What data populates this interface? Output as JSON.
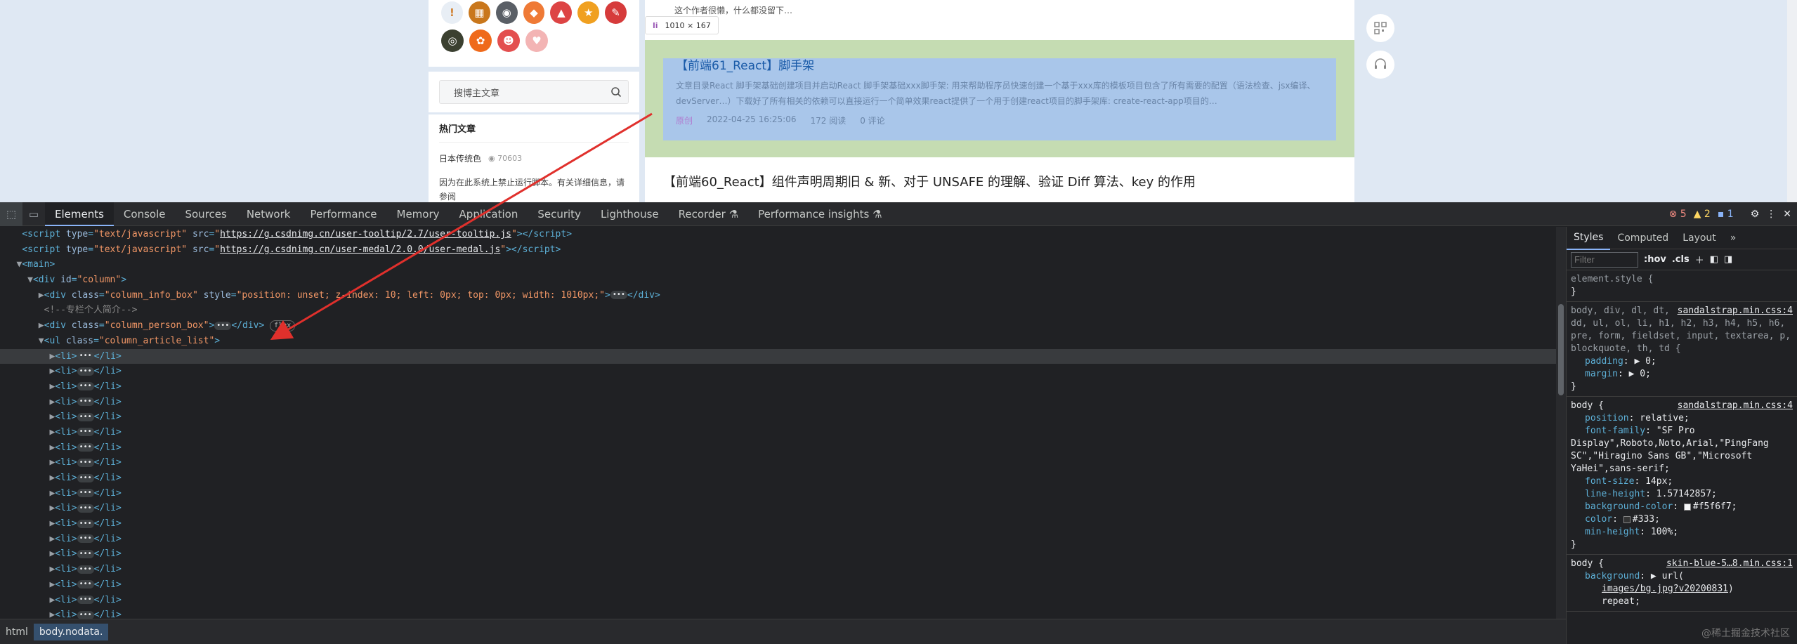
{
  "sidebar": {
    "search_placeholder": "搜博主文章",
    "hot_title": "热门文章",
    "hot_item_title": "日本传统色",
    "hot_item_views": "70603",
    "hot_item_note": "因为在此系统上禁止运行脚本。有关详细信息，请参阅"
  },
  "main": {
    "author_note": "这个作者很懒，什么都没留下…",
    "tooltip_size": "1010 × 167",
    "highlight": {
      "title": "【前端61_React】脚手架",
      "desc": "文章目录React 脚手架基础创建项目并启动React 脚手架基础xxx脚手架: 用来帮助程序员快速创建一个基于xxx库的模板项目包含了所有需要的配置（语法检查、jsx编译、devServer…）下载好了所有相关的依赖可以直接运行一个简单效果react提供了一个用于创建react项目的脚手架库: create-react-app项目的…",
      "badge": "原创",
      "date": "2022-04-25 16:25:06",
      "reads": "172 阅读",
      "comments": "0 评论"
    },
    "next_title": "【前端60_React】组件声明周期旧 & 新、对于 UNSAFE 的理解、验证 Diff 算法、key 的作用"
  },
  "devtools": {
    "tabs": [
      "Elements",
      "Console",
      "Sources",
      "Network",
      "Performance",
      "Memory",
      "Application",
      "Security",
      "Lighthouse",
      "Recorder ⚗",
      "Performance insights ⚗"
    ],
    "errors": "5",
    "warnings": "2",
    "infos": "1",
    "elements": {
      "script1_src": "https://g.csdnimg.cn/user-tooltip/2.7/user-tooltip.js",
      "script2_src": "https://g.csdnimg.cn/user-medal/2.0.0/user-medal.js",
      "column_id": "column",
      "info_box_class": "column_info_box",
      "info_box_style": "position: unset; z-index: 10; left: 0px; top: 0px; width: 1010px;",
      "comment": "<!--专栏个人简介-->",
      "person_box_class": "column_person_box",
      "flex_badge": "flex",
      "list_class": "column_article_list",
      "li_count": 18
    },
    "styles_tabs": [
      "Styles",
      "Computed",
      "Layout",
      "»"
    ],
    "filter_placeholder": "Filter",
    "filter_hov": ":hov",
    "filter_cls": ".cls",
    "element_style": "element.style {",
    "rule1_selector": "body, div, dl, dt, dd, ul, ol, li, h1, h2, h3, h4, h5, h6, pre, form, fieldset, input, textarea, p, blockquote, th, td {",
    "rule1_src": "sandalstrap.min.css:4",
    "rule2_src": "sandalstrap.min.css:4",
    "rule3_src": "skin-blue-5…8.min.css:1",
    "font_family_val": "\"SF Pro Display\",Roboto,Noto,Arial,\"PingFang SC\",\"Hiragino Sans GB\",\"Microsoft YaHei\",sans-serif;",
    "bg_color_val": "#f5f6f7;",
    "color_val": "#333;",
    "bg_url": "images/bg.jpg?v20200831",
    "breadcrumb": [
      "html",
      "body.nodata."
    ],
    "watermark": "@稀土掘金技术社区"
  }
}
